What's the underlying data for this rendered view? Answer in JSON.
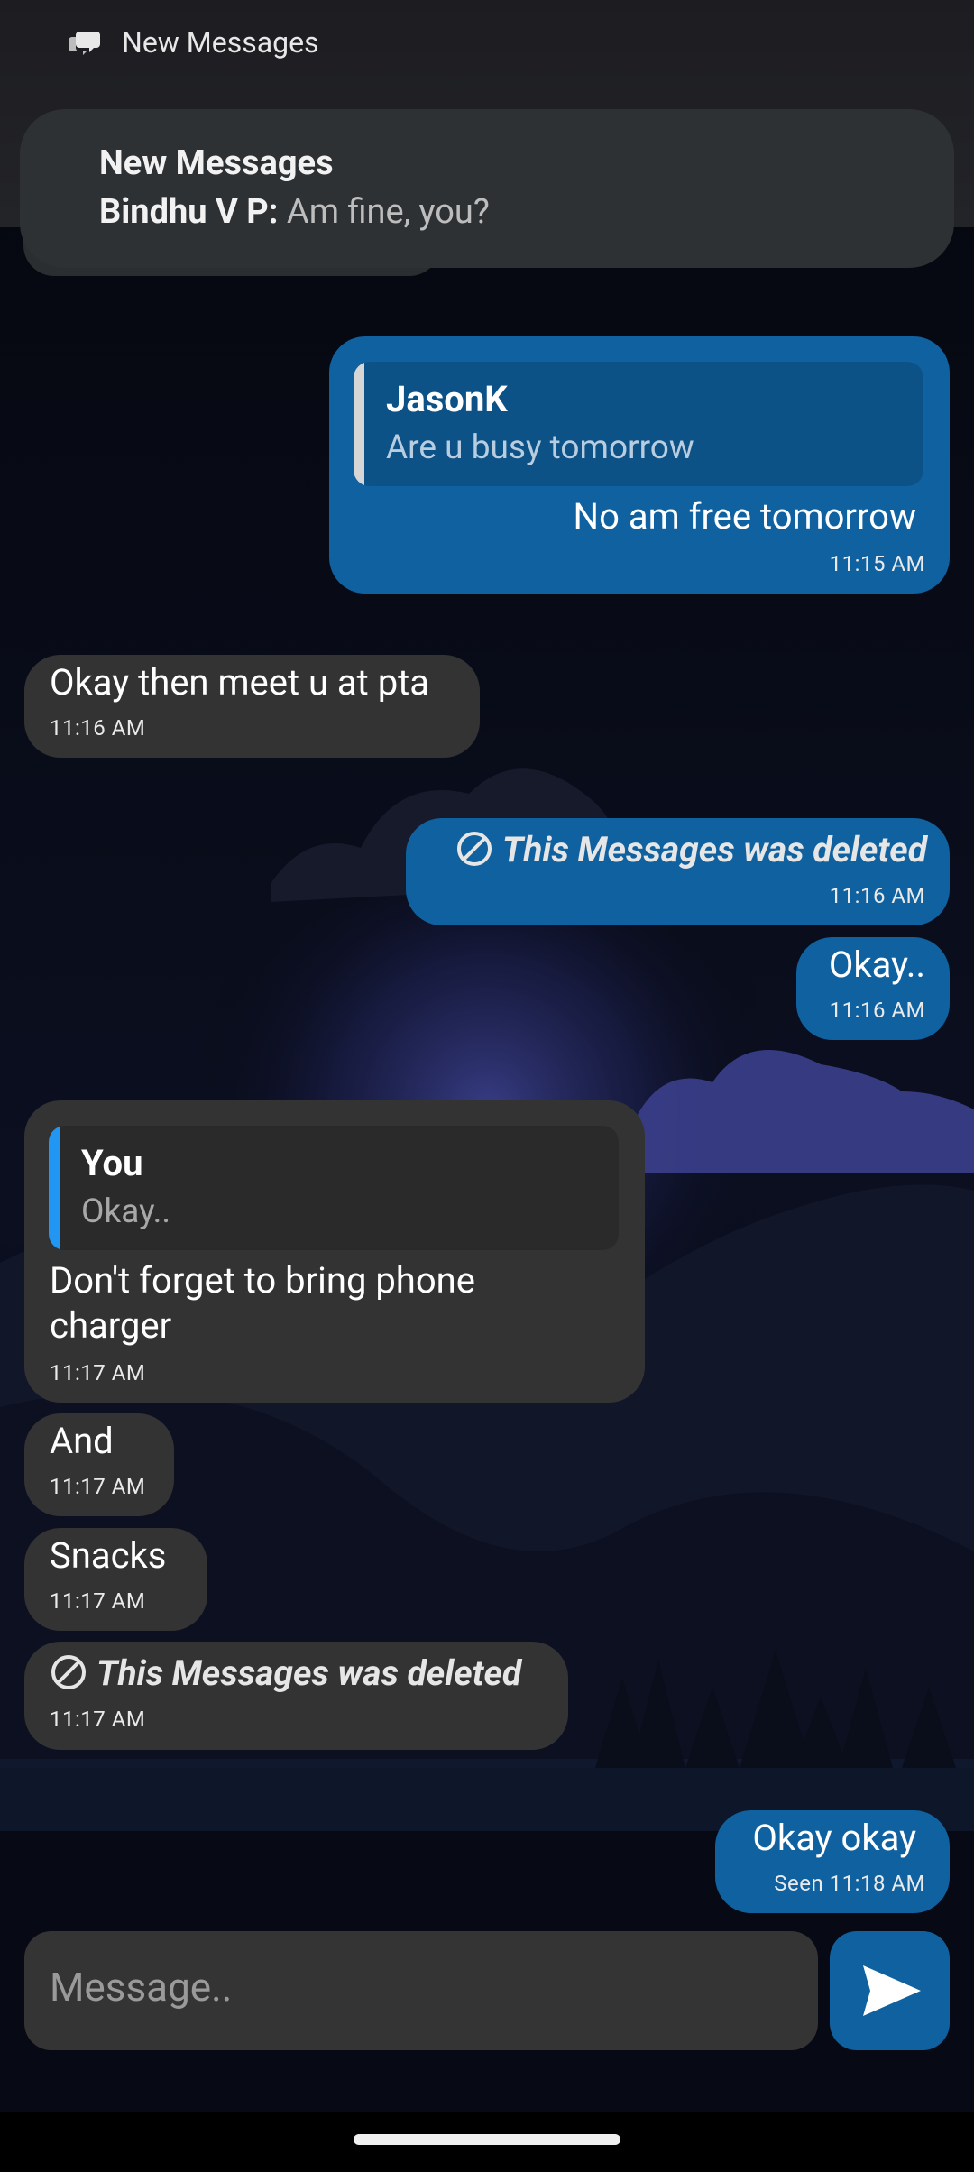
{
  "status_notification": {
    "title": "New Messages"
  },
  "heads_up": {
    "title": "New Messages",
    "sender": "Bindhu V P:",
    "preview": " Am fine, you?"
  },
  "messages": [
    {
      "side": "mine",
      "reply": {
        "author": "JasonK",
        "text": "Are u busy tomorrow"
      },
      "text": "No am free tomorrow",
      "time": "11:15 AM"
    },
    {
      "side": "theirs",
      "text": "Okay then meet u at pta",
      "time": "11:16 AM"
    },
    {
      "side": "mine",
      "deleted": true,
      "text": "This Messages was deleted",
      "time": "11:16 AM"
    },
    {
      "side": "mine",
      "text": "Okay..",
      "time": "11:16 AM"
    },
    {
      "side": "theirs",
      "reply": {
        "author": "You",
        "text": "Okay.."
      },
      "text_line1": "Don't forget to bring phone",
      "text_line2": "charger",
      "time": "11:17 AM"
    },
    {
      "side": "theirs",
      "text": "And",
      "time": "11:17 AM"
    },
    {
      "side": "theirs",
      "text": "Snacks",
      "time": "11:17 AM"
    },
    {
      "side": "theirs",
      "deleted": true,
      "text": "This Messages was deleted",
      "time": "11:17 AM"
    },
    {
      "side": "mine",
      "text": "Okay okay",
      "time": "Seen 11:18 AM"
    }
  ],
  "composer": {
    "placeholder": "Message..",
    "send_icon": "send-icon"
  },
  "colors": {
    "mine": "#1061a0",
    "theirs": "#333333",
    "accent": "#2196f3"
  }
}
